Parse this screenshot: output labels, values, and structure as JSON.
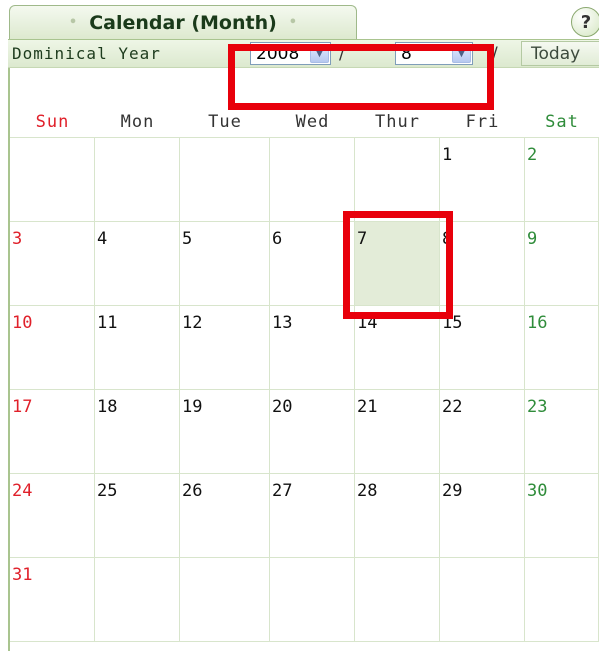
{
  "tab": {
    "title": "Calendar (Month)",
    "dot_left": "•",
    "dot_right": "•"
  },
  "help": {
    "label": "?"
  },
  "toolbar": {
    "label": "Dominical Year",
    "year": "2008",
    "separator": "/",
    "month": "8",
    "trailing_separator": "/",
    "today_label": "Today"
  },
  "weekdays": [
    "Sun",
    "Mon",
    "Tue",
    "Wed",
    "Thur",
    "Fri",
    "Sat"
  ],
  "weeks": [
    [
      "",
      "",
      "",
      "",
      "",
      "1",
      "2"
    ],
    [
      "3",
      "4",
      "5",
      "6",
      "7",
      "8",
      "9"
    ],
    [
      "10",
      "11",
      "12",
      "13",
      "14",
      "15",
      "16"
    ],
    [
      "17",
      "18",
      "19",
      "20",
      "21",
      "22",
      "23"
    ],
    [
      "24",
      "25",
      "26",
      "27",
      "28",
      "29",
      "30"
    ],
    [
      "31",
      "",
      "",
      "",
      "",
      "",
      ""
    ]
  ],
  "highlighted_day": "7",
  "colors": {
    "sunday": "#e0202a",
    "saturday": "#2f8c3a",
    "today_fill": "#e3ecd8",
    "annotation": "#e8000b",
    "frame": "#a9c48f"
  }
}
